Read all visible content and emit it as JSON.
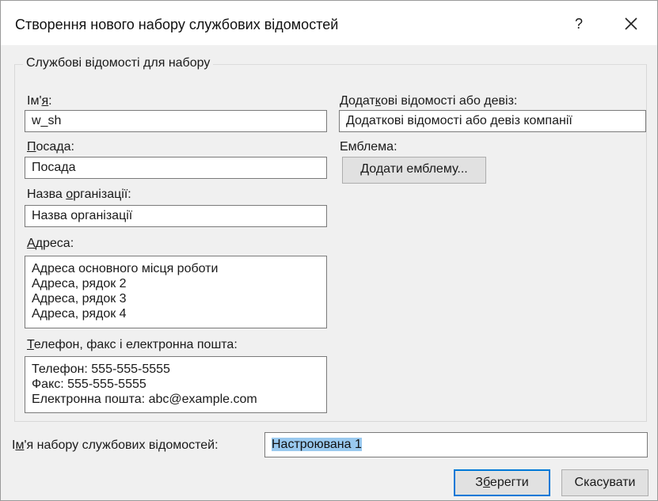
{
  "dialog": {
    "title": "Створення нового набору службових відомостей",
    "help_label": "?",
    "close_icon": "close-icon"
  },
  "group": {
    "legend": "Службові відомості для набору"
  },
  "name": {
    "label_pre": "Ім'",
    "label_acc": "я",
    "label_post": ":",
    "value": "w_sh"
  },
  "position": {
    "label_acc": "П",
    "label_post": "осада:",
    "value": "Посада"
  },
  "organization": {
    "label_pre": "Назва ",
    "label_acc": "о",
    "label_post": "рганізації:",
    "value": "Назва організації"
  },
  "address": {
    "label_acc": "А",
    "label_post": "дреса:",
    "lines": [
      "Адреса основного місця роботи",
      "Адреса, рядок 2",
      "Адреса, рядок 3",
      "Адреса, рядок 4"
    ]
  },
  "contacts": {
    "label_acc": "Т",
    "label_post": "елефон, факс і електронна пошта:",
    "lines": [
      "Телефон: 555-555-5555",
      "Факс: 555-555-5555",
      "Електронна пошта: abc@example.com"
    ]
  },
  "tagline": {
    "label_pre": "Додат",
    "label_acc": "к",
    "label_post": "ові відомості або девіз:",
    "value": "Додаткові відомості або девіз компанії"
  },
  "logo": {
    "label": "Емблема:",
    "button_pre": "",
    "button_acc": "Д",
    "button_post": "одати емблему..."
  },
  "set_name": {
    "label_pre": "І",
    "label_acc": "м",
    "label_post": "'я набору службових відомостей:",
    "value": "Настроювана 1"
  },
  "buttons": {
    "save_pre": "З",
    "save_acc": "б",
    "save_post": "ерегти",
    "cancel": "Скасувати"
  }
}
